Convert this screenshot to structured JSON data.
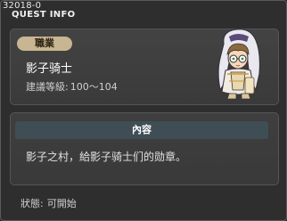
{
  "quest_id": "32018-0",
  "window_title": "QUEST INFO",
  "job": {
    "tag": "職業",
    "name": "影子骑士",
    "level_label": "建議等級:",
    "level_value": "100～104"
  },
  "content": {
    "header": "內容",
    "text": "影子之村，給影子骑士们的勋章。"
  },
  "status": {
    "label": "狀態:",
    "value": "可開始"
  },
  "npc": {
    "icon": "npc-portrait-icon"
  }
}
